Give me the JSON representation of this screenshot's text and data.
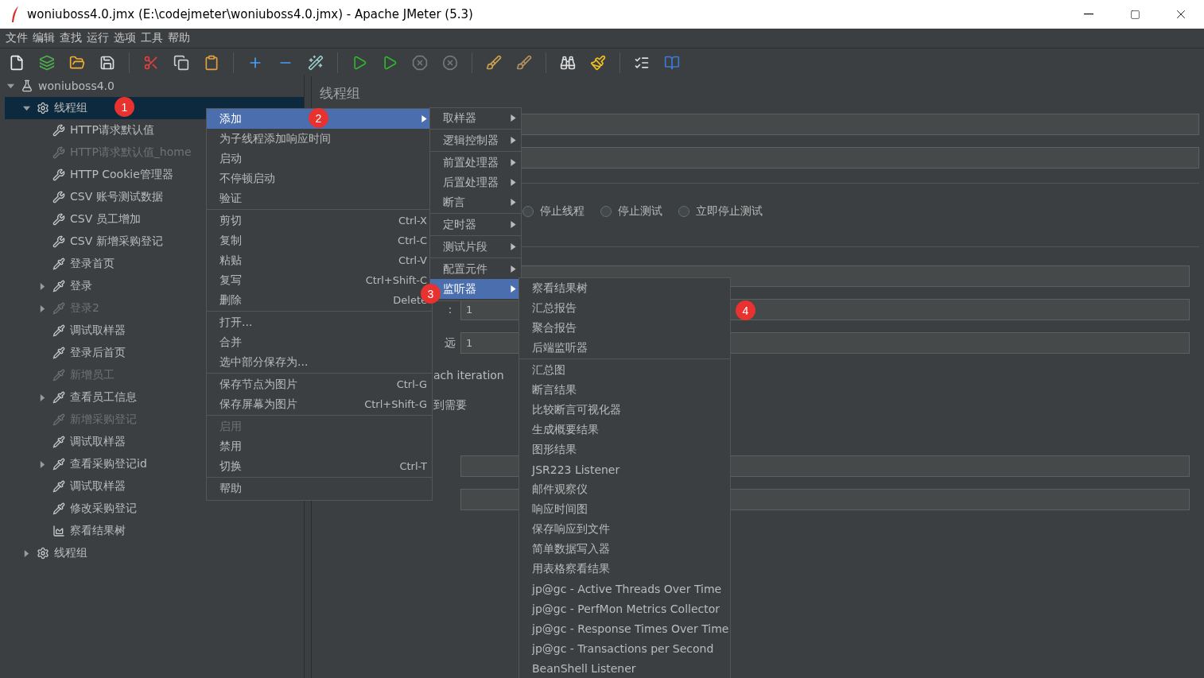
{
  "window": {
    "title": "woniuboss4.0.jmx (E:\\codejmeter\\woniuboss4.0.jmx) - Apache JMeter (5.3)"
  },
  "menubar": [
    "文件",
    "编辑",
    "查找",
    "运行",
    "选项",
    "工具",
    "帮助"
  ],
  "tree": [
    {
      "label": "woniuboss4.0",
      "kind": "plan",
      "disabled": false,
      "selected": false,
      "expanded": true,
      "children": [
        {
          "label": "线程组",
          "kind": "thread-group",
          "disabled": false,
          "selected": true,
          "expanded": true,
          "children": [
            {
              "label": "HTTP请求默认值",
              "kind": "config",
              "disabled": false,
              "selected": false
            },
            {
              "label": "HTTP请求默认值_home",
              "kind": "config",
              "disabled": true,
              "selected": false
            },
            {
              "label": "HTTP Cookie管理器",
              "kind": "config",
              "disabled": false,
              "selected": false
            },
            {
              "label": "CSV 账号测试数据",
              "kind": "config",
              "disabled": false,
              "selected": false
            },
            {
              "label": "CSV 员工增加",
              "kind": "config",
              "disabled": false,
              "selected": false
            },
            {
              "label": "CSV 新增采购登记",
              "kind": "config",
              "disabled": false,
              "selected": false
            },
            {
              "label": "登录首页",
              "kind": "sampler",
              "disabled": false,
              "selected": false
            },
            {
              "label": "登录",
              "kind": "sampler",
              "disabled": false,
              "selected": false,
              "expanded": false
            },
            {
              "label": "登录2",
              "kind": "sampler",
              "disabled": true,
              "selected": false,
              "expanded": false
            },
            {
              "label": "调试取样器",
              "kind": "sampler",
              "disabled": false,
              "selected": false
            },
            {
              "label": "登录后首页",
              "kind": "sampler",
              "disabled": false,
              "selected": false
            },
            {
              "label": "新增员工",
              "kind": "sampler",
              "disabled": true,
              "selected": false
            },
            {
              "label": "查看员工信息",
              "kind": "sampler",
              "disabled": false,
              "selected": false,
              "expanded": false
            },
            {
              "label": "新增采购登记",
              "kind": "sampler",
              "disabled": true,
              "selected": false
            },
            {
              "label": "调试取样器",
              "kind": "sampler",
              "disabled": false,
              "selected": false
            },
            {
              "label": "查看采购登记id",
              "kind": "sampler",
              "disabled": false,
              "selected": false,
              "expanded": false
            },
            {
              "label": "调试取样器",
              "kind": "sampler",
              "disabled": false,
              "selected": false
            },
            {
              "label": "修改采购登记",
              "kind": "sampler",
              "disabled": false,
              "selected": false
            },
            {
              "label": "察看结果树",
              "kind": "listener",
              "disabled": false,
              "selected": false
            }
          ]
        },
        {
          "label": "线程组",
          "kind": "thread-group",
          "disabled": false,
          "selected": false,
          "expanded": false
        }
      ]
    }
  ],
  "panel": {
    "title": "线程组",
    "rows": [
      {
        "kind": "field"
      },
      {
        "kind": "field"
      },
      {
        "kind": "separator"
      },
      {
        "kind": "radios",
        "options": [
          {
            "label": "停止线程",
            "selected": false
          },
          {
            "label": "停止测试",
            "selected": false
          },
          {
            "label": "立即停止测试",
            "selected": false
          }
        ]
      },
      {
        "kind": "separator"
      },
      {
        "kind": "field"
      },
      {
        "kind": "field",
        "label": "：",
        "value": "1"
      },
      {
        "kind": "field",
        "label": "远",
        "value": "1"
      },
      {
        "kind": "text",
        "text": "ach iteration"
      },
      {
        "kind": "text",
        "text": "到需要"
      },
      {
        "kind": "field"
      },
      {
        "kind": "field"
      }
    ]
  },
  "context_menu": {
    "groups": [
      [
        {
          "label": "添加",
          "selected": true,
          "disabled": false,
          "submenu": true
        },
        {
          "label": "为子线程添加响应时间",
          "selected": false,
          "disabled": false,
          "submenu": false
        },
        {
          "label": "启动",
          "selected": false,
          "disabled": false,
          "submenu": false
        },
        {
          "label": "不停顿启动",
          "selected": false,
          "disabled": false,
          "submenu": false
        },
        {
          "label": "验证",
          "selected": false,
          "disabled": false,
          "submenu": false
        }
      ],
      [
        {
          "label": "剪切",
          "shortcut": "Ctrl-X",
          "selected": false,
          "disabled": false,
          "submenu": false
        },
        {
          "label": "复制",
          "shortcut": "Ctrl-C",
          "selected": false,
          "disabled": false,
          "submenu": false
        },
        {
          "label": "粘贴",
          "shortcut": "Ctrl-V",
          "selected": false,
          "disabled": false,
          "submenu": false
        },
        {
          "label": "复写",
          "shortcut": "Ctrl+Shift-C",
          "selected": false,
          "disabled": false,
          "submenu": false
        },
        {
          "label": "删除",
          "shortcut": "Delete",
          "selected": false,
          "disabled": false,
          "submenu": false
        }
      ],
      [
        {
          "label": "打开...",
          "selected": false,
          "disabled": false,
          "submenu": false
        },
        {
          "label": "合并",
          "selected": false,
          "disabled": false,
          "submenu": false
        },
        {
          "label": "选中部分保存为...",
          "selected": false,
          "disabled": false,
          "submenu": false
        }
      ],
      [
        {
          "label": "保存节点为图片",
          "shortcut": "Ctrl-G",
          "selected": false,
          "disabled": false,
          "submenu": false
        },
        {
          "label": "保存屏幕为图片",
          "shortcut": "Ctrl+Shift-G",
          "selected": false,
          "disabled": false,
          "submenu": false
        }
      ],
      [
        {
          "label": "启用",
          "selected": false,
          "disabled": true,
          "submenu": false
        },
        {
          "label": "禁用",
          "selected": false,
          "disabled": false,
          "submenu": false
        },
        {
          "label": "切换",
          "shortcut": "Ctrl-T",
          "selected": false,
          "disabled": false,
          "submenu": false
        }
      ],
      [
        {
          "label": "帮助",
          "selected": false,
          "disabled": false,
          "submenu": false
        }
      ]
    ]
  },
  "add_submenu": {
    "groups": [
      [
        {
          "label": "取样器",
          "selected": false
        }
      ],
      [
        {
          "label": "逻辑控制器",
          "selected": false
        }
      ],
      [
        {
          "label": "前置处理器",
          "selected": false
        },
        {
          "label": "后置处理器",
          "selected": false
        },
        {
          "label": "断言",
          "selected": false
        }
      ],
      [
        {
          "label": "定时器",
          "selected": false
        }
      ],
      [
        {
          "label": "测试片段",
          "selected": false
        }
      ],
      [
        {
          "label": "配置元件",
          "selected": false
        },
        {
          "label": "监听器",
          "selected": true
        }
      ]
    ]
  },
  "listener_submenu": {
    "groups": [
      [
        {
          "label": "察看结果树",
          "selected": false
        },
        {
          "label": "汇总报告",
          "selected": false
        },
        {
          "label": "聚合报告",
          "selected": false
        },
        {
          "label": "后端监听器",
          "selected": false
        }
      ],
      [
        {
          "label": "汇总图",
          "selected": false
        },
        {
          "label": "断言结果",
          "selected": false
        },
        {
          "label": "比较断言可视化器",
          "selected": false
        },
        {
          "label": "生成概要结果",
          "selected": false
        },
        {
          "label": "图形结果",
          "selected": false
        },
        {
          "label": "JSR223 Listener",
          "selected": false
        },
        {
          "label": "邮件观察仪",
          "selected": false
        },
        {
          "label": "响应时间图",
          "selected": false
        },
        {
          "label": "保存响应到文件",
          "selected": false
        },
        {
          "label": "简单数据写入器",
          "selected": false
        },
        {
          "label": "用表格察看结果",
          "selected": false
        },
        {
          "label": "jp@gc - Active Threads Over Time",
          "selected": false
        },
        {
          "label": "jp@gc - PerfMon Metrics Collector",
          "selected": false
        },
        {
          "label": "jp@gc - Response Times Over Time",
          "selected": false
        },
        {
          "label": "jp@gc - Transactions per Second",
          "selected": false
        },
        {
          "label": "BeanShell Listener",
          "selected": false
        }
      ]
    ]
  },
  "annotations": [
    {
      "label": "1"
    },
    {
      "label": "2"
    },
    {
      "label": "3"
    },
    {
      "label": "4"
    }
  ]
}
